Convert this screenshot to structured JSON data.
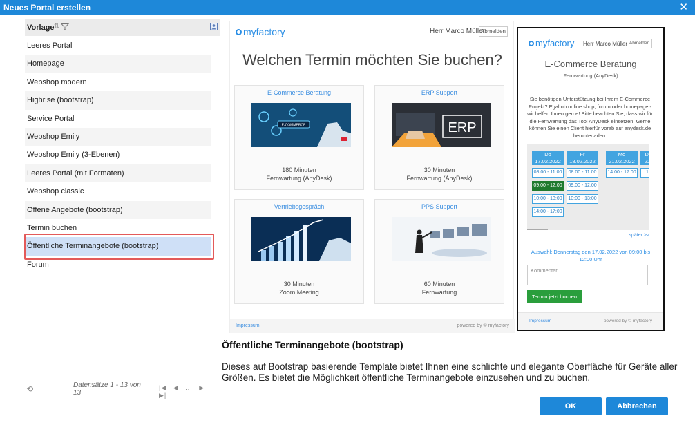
{
  "window": {
    "title": "Neues Portal erstellen",
    "close_icon": "close-icon"
  },
  "list": {
    "header_label": "Vorlage",
    "items": [
      "Leeres Portal",
      "Homepage",
      "Webshop modern",
      "Highrise (bootstrap)",
      "Service Portal",
      "Webshop Emily",
      "Webshop Emily (3-Ebenen)",
      "Leeres Portal (mit Formaten)",
      "Webshop classic",
      "Offene Angebote (bootstrap)",
      "Termin buchen",
      "Öffentliche Terminangebote (bootstrap)",
      "Forum"
    ],
    "selected_index": 11,
    "pager_text": "Datensätze 1 - 13 von 13",
    "pager_ellipsis": "..."
  },
  "preview": {
    "logo": "myfactory",
    "user": "Herr Marco Müller",
    "logout": "Abmelden",
    "heading": "Welchen Termin möchten Sie buchen?",
    "cards": [
      {
        "title": "E-Commerce Beratung",
        "duration": "180 Minuten",
        "mode": "Fernwartung (AnyDesk)",
        "image_text": "E-COMMERCE"
      },
      {
        "title": "ERP Support",
        "duration": "30 Minuten",
        "mode": "Fernwartung (AnyDesk)",
        "image_text": "ERP"
      },
      {
        "title": "Vertriebsgespräch",
        "duration": "30 Minuten",
        "mode": "Zoom Meeting"
      },
      {
        "title": "PPS Support",
        "duration": "60 Minuten",
        "mode": "Fernwartung"
      }
    ],
    "footer_left": "Impressum",
    "footer_right": "powered by © myfactory"
  },
  "mobile": {
    "logo": "myfactory",
    "user": "Herr Marco Müller",
    "logout": "Abmelden",
    "title": "E-Commerce Beratung",
    "subtitle": "Fernwartung (AnyDesk)",
    "description": "Sie benötigen Unterstützung bei Ihrem E-Commerce Projekt? Egal ob online shop, forum oder homepage - wir helfen Ihnen gerne! Bitte beachten Sie, dass wir für die Fernwartung das Tool AnyDesk einsetzen. Gerne können Sie einen Client hierfür vorab auf anydesk.de herunterladen.",
    "days": [
      {
        "name": "Do",
        "date": "17.02.2022",
        "slots": [
          "08:00 - 11:00",
          "09:00 - 12:00",
          "10:00 - 13:00",
          "14:00 - 17:00"
        ]
      },
      {
        "name": "Fr",
        "date": "18.02.2022",
        "slots": [
          "08:00 - 11:00",
          "09:00 - 12:00",
          "10:00 - 13:00"
        ]
      },
      {
        "name": "Mo",
        "date": "21.02.2022",
        "slots": [
          "14:00 - 17:00"
        ]
      },
      {
        "name": "Di",
        "date": "22",
        "slots": [
          "1"
        ]
      }
    ],
    "later": "später >>",
    "choice": "Auswahl: Donnerstag den 17.02.2022 von 09:00 bis 12:00 Uhr",
    "comment_placeholder": "Kommentar",
    "book_button": "Termin jetzt buchen",
    "footer_left": "Impressum",
    "footer_right": "powered by © myfactory"
  },
  "description": {
    "title": "Öffentliche Terminangebote (bootstrap)",
    "text": "Dieses auf Bootstrap basierende Template bietet Ihnen eine schlichte und elegante Oberfläche für Geräte aller Größen. Es bietet die Möglichkeit öffentliche Terminangebote einzusehen und zu buchen."
  },
  "buttons": {
    "ok": "OK",
    "cancel": "Abbrechen"
  },
  "colors": {
    "accent": "#1e88d9",
    "selection": "#cfe0f7",
    "highlight_frame": "#e35a5a",
    "slot_active": "#1f7a2e"
  }
}
